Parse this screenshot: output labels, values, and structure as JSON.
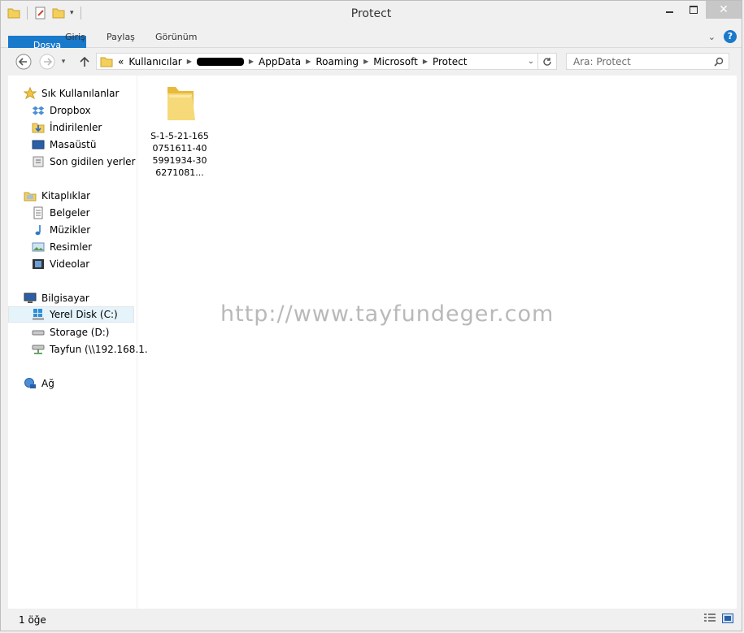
{
  "window": {
    "title": "Protect"
  },
  "ribbon": {
    "tabs": [
      {
        "label": "Dosya"
      },
      {
        "label": "Giriş"
      },
      {
        "label": "Paylaş"
      },
      {
        "label": "Görünüm"
      }
    ]
  },
  "address": {
    "overflow": "«",
    "crumbs": [
      "Kullanıcılar",
      "AppData",
      "Roaming",
      "Microsoft",
      "Protect"
    ]
  },
  "search": {
    "placeholder": "Ara: Protect"
  },
  "sidebar": {
    "favorites": {
      "label": "Sık Kullanılanlar",
      "items": [
        "Dropbox",
        "İndirilenler",
        "Masaüstü",
        "Son gidilen yerler"
      ]
    },
    "libraries": {
      "label": "Kitaplıklar",
      "items": [
        "Belgeler",
        "Müzikler",
        "Resimler",
        "Videolar"
      ]
    },
    "computer": {
      "label": "Bilgisayar",
      "items": [
        "Yerel Disk (C:)",
        "Storage (D:)",
        "Tayfun (\\\\192.168.1."
      ]
    },
    "network": {
      "label": "Ağ"
    }
  },
  "files": [
    {
      "name": "S-1-5-21-1650751611-405991934-306271081..."
    }
  ],
  "watermark": "http://www.tayfundeger.com",
  "status": {
    "count": "1 öğe"
  },
  "colors": {
    "accent": "#1979ca",
    "selection": "#e5f3fb",
    "folder": "#f3cf5b"
  }
}
